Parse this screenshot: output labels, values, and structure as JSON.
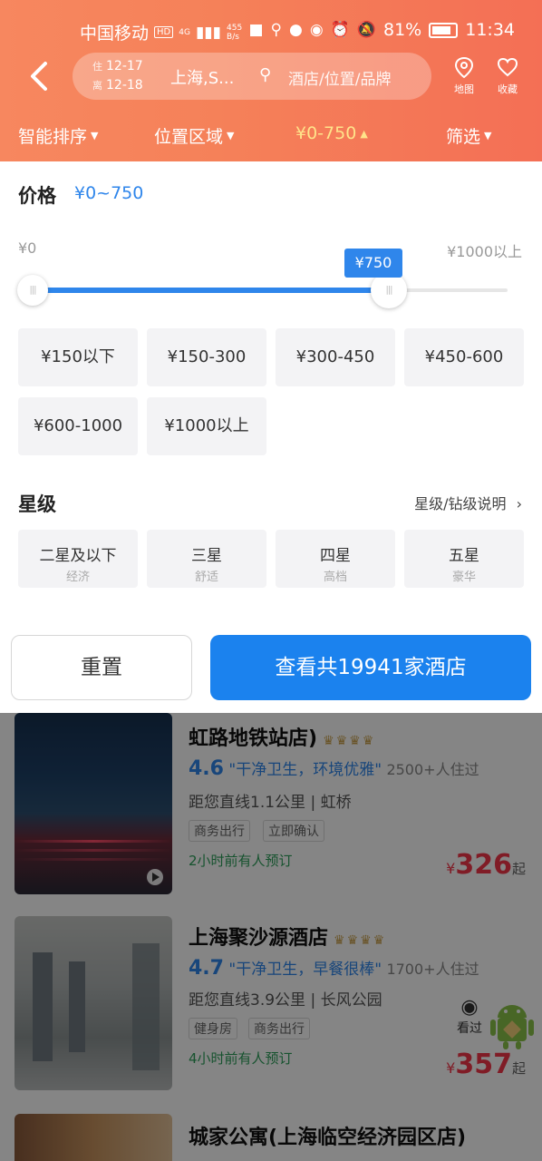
{
  "status_bar": {
    "carrier": "中国移动",
    "hd": "HD",
    "net": "4G",
    "speed_top": "455",
    "speed_bottom": "B/s",
    "battery": "81%",
    "time": "11:34"
  },
  "search": {
    "checkin_label": "住",
    "checkin": "12-17",
    "checkout_label": "离",
    "checkout": "12-18",
    "city": "上海,S...",
    "placeholder": "酒店/位置/品牌"
  },
  "header_buttons": {
    "map": "地图",
    "favorite": "收藏"
  },
  "filter_bar": {
    "sort": "智能排序",
    "location": "位置区域",
    "price": "¥0-750",
    "filter": "筛选"
  },
  "price_section": {
    "title": "价格",
    "value": "¥0~750",
    "min_label": "¥0",
    "max_label": "¥1000以上",
    "tooltip": "¥750",
    "range_min": 0,
    "range_max": 1000,
    "selected_low": 0,
    "selected_high": 750,
    "chips": [
      "¥150以下",
      "¥150-300",
      "¥300-450",
      "¥450-600",
      "¥600-1000",
      "¥1000以上"
    ]
  },
  "star_section": {
    "title": "星级",
    "help": "星级/钻级说明",
    "chips": [
      {
        "main": "二星及以下",
        "sub": "经济"
      },
      {
        "main": "三星",
        "sub": "舒适"
      },
      {
        "main": "四星",
        "sub": "高档"
      },
      {
        "main": "五星",
        "sub": "豪华"
      }
    ]
  },
  "actions": {
    "reset": "重置",
    "view": "查看共19941家酒店"
  },
  "hotels": [
    {
      "name": "虹路地铁站店)",
      "crowns": "♛♛♛♛",
      "score": "4.6",
      "quote": "\"干净卫生，环境优雅\"",
      "guests": "2500+人住过",
      "distance": "距您直线1.1公里",
      "area": "虹桥",
      "tags": [
        "商务出行",
        "立即确认"
      ],
      "booked": "2小时前有人预订",
      "currency": "¥",
      "price": "326",
      "price_suffix": "起"
    },
    {
      "name": "上海聚沙源酒店",
      "crowns": "♛♛♛♛",
      "score": "4.7",
      "quote": "\"干净卫生，早餐很棒\"",
      "guests": "1700+人住过",
      "distance": "距您直线3.9公里",
      "area": "长风公园",
      "tags": [
        "健身房",
        "商务出行"
      ],
      "booked": "4小时前有人预订",
      "currency": "¥",
      "price": "357",
      "price_suffix": "起"
    },
    {
      "name": "城家公寓(上海临空经济园区店)"
    }
  ],
  "seen_label": "看过"
}
